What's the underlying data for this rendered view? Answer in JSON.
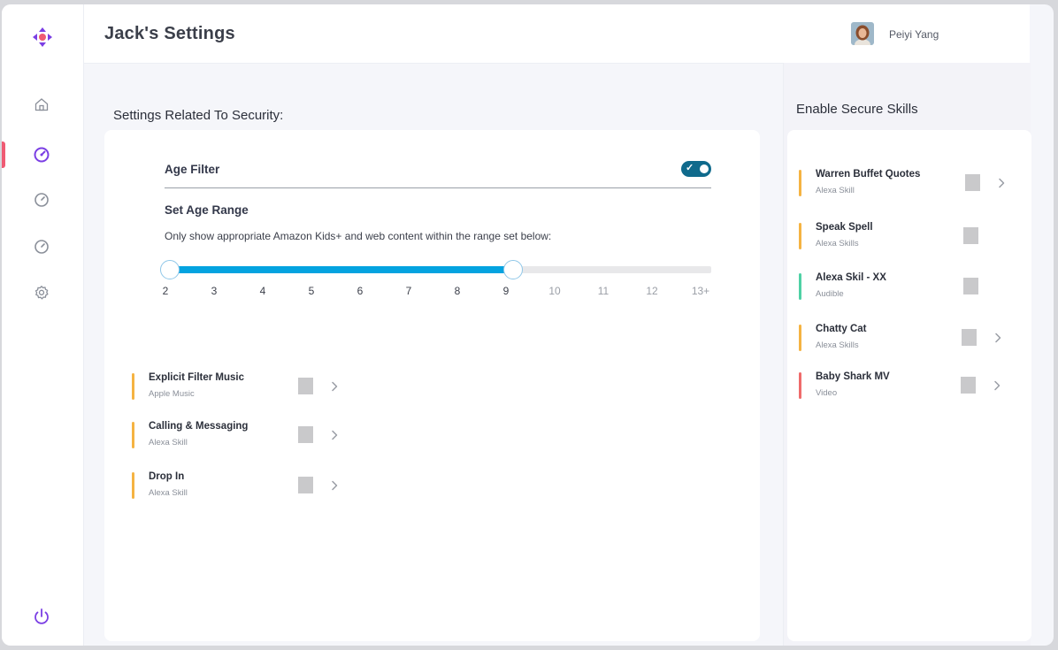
{
  "header": {
    "title": "Jack's Settings",
    "user_name": "Peiyi Yang"
  },
  "sidebar": {
    "items": [
      {
        "icon": "home-icon"
      },
      {
        "icon": "gauge-icon",
        "active": true
      },
      {
        "icon": "gauge-icon"
      },
      {
        "icon": "gauge-icon"
      },
      {
        "icon": "gear-icon"
      }
    ],
    "bottom_icon": "power-icon"
  },
  "security": {
    "section_title": "Settings Related To Security:",
    "age_filter_label": "Age Filter",
    "age_filter_on": true,
    "set_age_range_label": "Set Age Range",
    "range_description": "Only show appropriate Amazon Kids+ and web content within the range set below:",
    "ticks": [
      "2",
      "3",
      "4",
      "5",
      "6",
      "7",
      "8",
      "9",
      "10",
      "11",
      "12",
      "13+"
    ],
    "range_min": "2",
    "range_max": "9",
    "items": [
      {
        "name": "Explicit Filter Music",
        "sub": "Apple Music",
        "color": "#f5b342"
      },
      {
        "name": "Calling & Messaging",
        "sub": "Alexa Skill",
        "color": "#f5b342"
      },
      {
        "name": "Drop In",
        "sub": "Alexa Skill",
        "color": "#f5b342"
      }
    ]
  },
  "secure_skills": {
    "section_title": "Enable Secure Skills",
    "items": [
      {
        "name": "Warren Buffet Quotes",
        "sub": "Alexa Skill",
        "color": "#f5b342",
        "chevron": true
      },
      {
        "name": "Speak Spell",
        "sub": "Alexa Skills",
        "color": "#f5b342",
        "chevron": false
      },
      {
        "name": "Alexa Skil - XX",
        "sub": "Audible",
        "color": "#4fd1a5",
        "chevron": false
      },
      {
        "name": "Chatty Cat",
        "sub": "Alexa Skills",
        "color": "#f5b342",
        "chevron": true
      },
      {
        "name": "Baby Shark MV",
        "sub": "Video",
        "color": "#ef6b6b",
        "chevron": true
      }
    ]
  },
  "colors": {
    "accent": "#04a3e0",
    "brand": "#7b3fe4",
    "active_indicator": "#ef5b73",
    "toggle": "#0f6a8c"
  }
}
